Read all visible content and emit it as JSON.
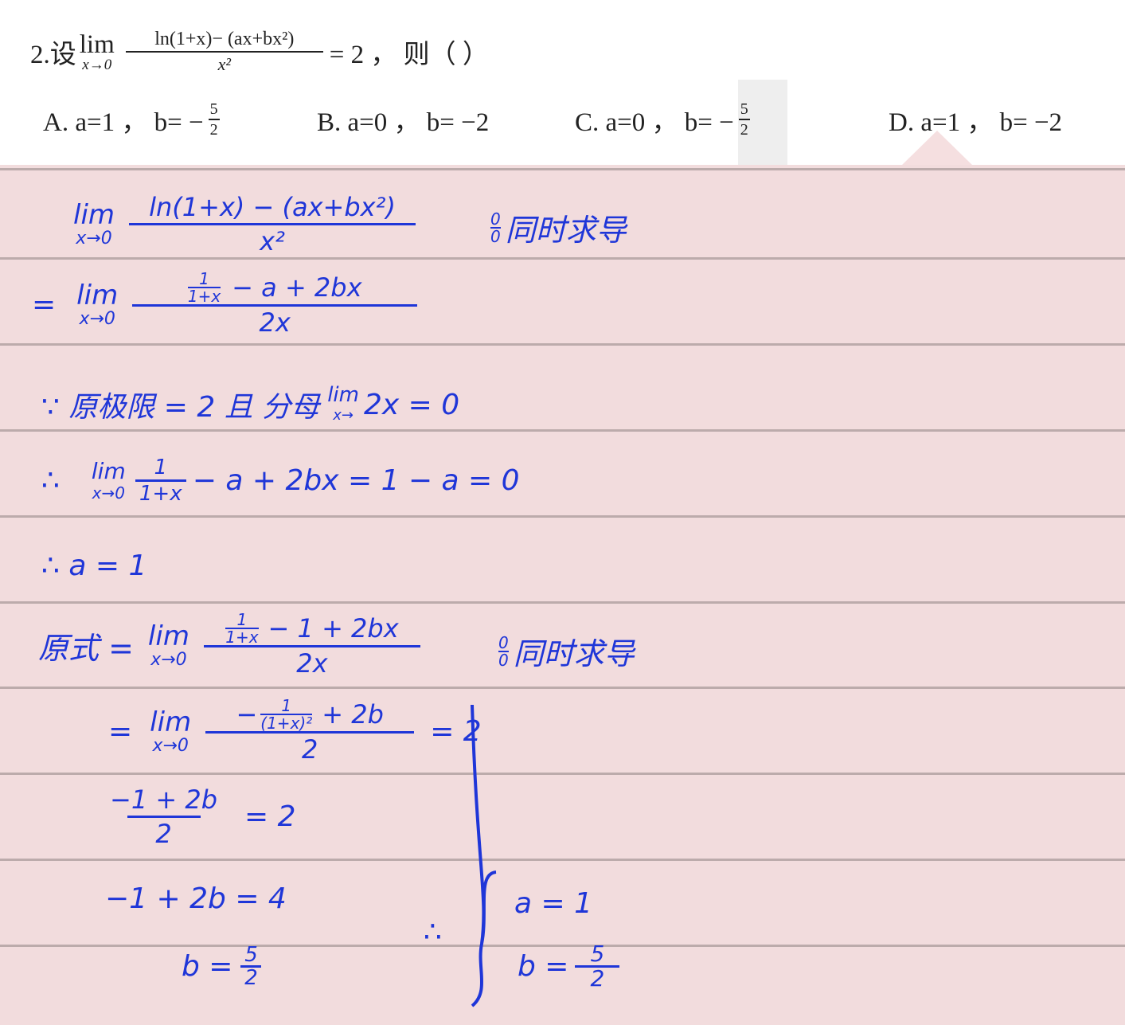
{
  "question": {
    "prefix": "2.设",
    "lim_word": "lim",
    "lim_sub": "x→0",
    "numerator": "ln(1+x)− (ax+bx²)",
    "denominator": "x²",
    "rest": "= 2 ，  则（ ）",
    "options": [
      {
        "head": "A. a=1 ， b= −",
        "frac_num": "5",
        "frac_den": "2"
      },
      {
        "head": "B. a=0 ， b= −2"
      },
      {
        "head": "C. a=0 ， b= −",
        "frac_num": "5",
        "frac_den": "2"
      },
      {
        "head": "D. a=1 ， b= −2"
      }
    ]
  },
  "solution": {
    "step1": {
      "lim": "lim",
      "sub": "x→0",
      "num": "ln(1+x) − (ax+bx²)",
      "den": "x²",
      "note_num": "0",
      "note_den": "0",
      "note": "同时求导"
    },
    "step2": {
      "eq": "=",
      "lim": "lim",
      "sub": "x→0",
      "num_frac_num": "1",
      "num_frac_den": "1+x",
      "num_rest": "− a + 2bx",
      "den": "2x"
    },
    "step3": {
      "text": "∵ 原极限 = 2  且 分母",
      "lim": "lim",
      "sub": "x→",
      "tail": "2x = 0"
    },
    "step4": {
      "pre": "∴",
      "lim": "lim",
      "sub": "x→0",
      "frac_num": "1",
      "frac_den": "1+x",
      "tail": "− a + 2bx = 1 − a = 0"
    },
    "step5": {
      "text": "∴   a = 1"
    },
    "step6": {
      "label": "原式 =",
      "lim": "lim",
      "sub": "x→0",
      "num_frac_num": "1",
      "num_frac_den": "1+x",
      "num_rest": "− 1 + 2bx",
      "den": "2x",
      "note_num": "0",
      "note_den": "0",
      "note": "同时求导"
    },
    "step7": {
      "eq": "=",
      "lim": "lim",
      "sub": "x→0",
      "num_pre": "−",
      "num_frac_num": "1",
      "num_frac_den": "(1+x)²",
      "num_rest": "+ 2b",
      "den": "2",
      "rhs": "= 2"
    },
    "step8": {
      "num": "−1 + 2b",
      "den": "2",
      "rhs": "= 2"
    },
    "step9": {
      "text": "−1 + 2b = 4"
    },
    "step10": {
      "lhs": "b =",
      "num": "5",
      "den": "2"
    },
    "conclusion": {
      "therefore": "∴",
      "line1": "a = 1",
      "line2_lhs": "b =",
      "line2_num": "5",
      "line2_den": "2"
    }
  }
}
